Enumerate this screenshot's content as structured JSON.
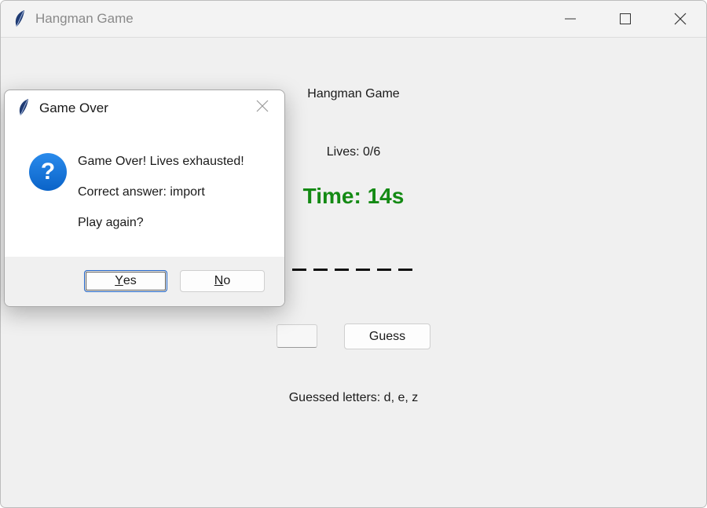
{
  "window": {
    "title": "Hangman Game"
  },
  "game": {
    "title": "Hangman Game",
    "lives": "Lives: 0/6",
    "timer": "Time: 14s",
    "word_slots": 6,
    "guess_button": "Guess",
    "guessed_letters": "Guessed letters: d, e, z"
  },
  "dialog": {
    "title": "Game Over",
    "line1": "Game Over! Lives exhausted!",
    "line2": "Correct answer: import",
    "line3": "Play again?",
    "yes_first": "Y",
    "yes_rest": "es",
    "no_first": "N",
    "no_rest": "o"
  },
  "colors": {
    "timer": "#148a14",
    "question_icon": "#0a63c8"
  }
}
